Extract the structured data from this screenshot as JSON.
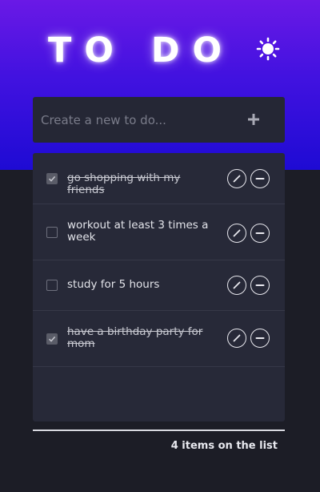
{
  "header": {
    "title": "TO DO",
    "theme_icon": "sun-icon"
  },
  "new_todo": {
    "placeholder": "Create a new to do...",
    "value": "",
    "add_icon": "plus-icon"
  },
  "todos": [
    {
      "text": "go shopping with my friends",
      "completed": true
    },
    {
      "text": "workout at least 3 times a week",
      "completed": false
    },
    {
      "text": "study for 5 hours",
      "completed": false
    },
    {
      "text": "have a birthday party for mom",
      "completed": true
    }
  ],
  "row_actions": {
    "edit_icon": "pencil-icon",
    "delete_icon": "minus-icon"
  },
  "footer": {
    "count_text": "4 items on the list"
  },
  "colors": {
    "gradient_top": "#6a19e6",
    "gradient_bottom": "#1e0bd4",
    "background": "#1c1d26",
    "card": "#272938"
  }
}
